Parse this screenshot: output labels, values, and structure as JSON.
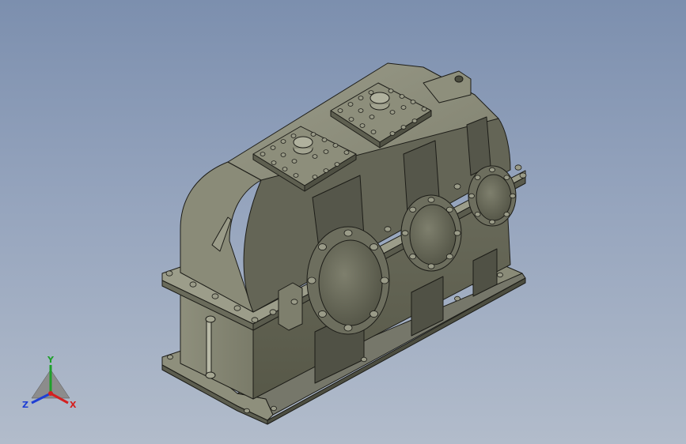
{
  "model": {
    "name": "gearbox-housing",
    "colors": {
      "body_light": "#8b8c7a",
      "body_mid": "#6f7060",
      "body_dark": "#4f5044",
      "edge": "#1d1d18",
      "bolt": "#9a9b88"
    }
  },
  "triad": {
    "x_label": "X",
    "y_label": "Y",
    "z_label": "Z",
    "x_color": "#d42020",
    "y_color": "#1ea02a",
    "z_color": "#1f3fd4"
  }
}
